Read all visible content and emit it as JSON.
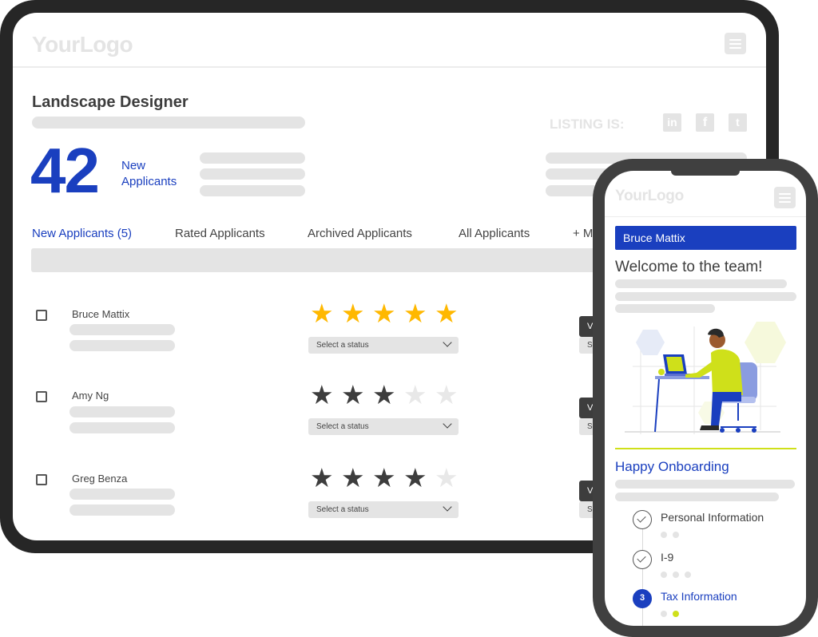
{
  "tablet": {
    "logo": "YourLogo",
    "menu_icon": "hamburger-menu-icon",
    "job_title": "Landscape Designer",
    "new_applicants_count": "42",
    "new_applicants_label_line1": "New",
    "new_applicants_label_line2": "Applicants",
    "listing_label": "LISTING IS:",
    "social_icons": [
      {
        "name": "linkedin-icon",
        "glyph": "in"
      },
      {
        "name": "facebook-icon",
        "glyph": "f"
      },
      {
        "name": "twitter-icon",
        "glyph": "t"
      }
    ],
    "tabs": [
      {
        "label": "New Applicants (5)",
        "active": true
      },
      {
        "label": "Rated Applicants",
        "active": false
      },
      {
        "label": "Archived Applicants",
        "active": false
      },
      {
        "label": "All Applicants",
        "active": false
      },
      {
        "label": "+ M",
        "active": false
      }
    ],
    "applicants": [
      {
        "name": "Bruce Mattix",
        "rating": 5,
        "rating_style": "gold",
        "status_placeholder": "Select a status",
        "view_label": "V",
        "status2_label": "S"
      },
      {
        "name": "Amy Ng",
        "rating": 3,
        "rating_style": "dark",
        "status_placeholder": "Select a status",
        "view_label": "V",
        "status2_label": "S"
      },
      {
        "name": "Greg Benza",
        "rating": 4,
        "rating_style": "dark",
        "status_placeholder": "Select a status",
        "view_label": "V",
        "status2_label": "S"
      }
    ],
    "max_rating": 5
  },
  "phone": {
    "logo": "YourLogo",
    "menu_icon": "hamburger-menu-icon",
    "user_name": "Bruce Mattix",
    "welcome": "Welcome to the team!",
    "illustration": "person-at-desk-illustration",
    "section_title": "Happy Onboarding",
    "steps": [
      {
        "label": "Personal Information",
        "state": "done",
        "dots": 2,
        "active_dot": -1
      },
      {
        "label": "I-9",
        "state": "done",
        "dots": 3,
        "active_dot": -1
      },
      {
        "label": "Tax Information",
        "state": "current",
        "number": "3",
        "dots": 2,
        "active_dot": 1
      }
    ]
  },
  "colors": {
    "brand_blue": "#1a3fbf",
    "accent_lime": "#cfe01a",
    "star_gold": "#ffb800",
    "star_dark": "#3d3d3d",
    "placeholder_gray": "#e4e4e4"
  }
}
